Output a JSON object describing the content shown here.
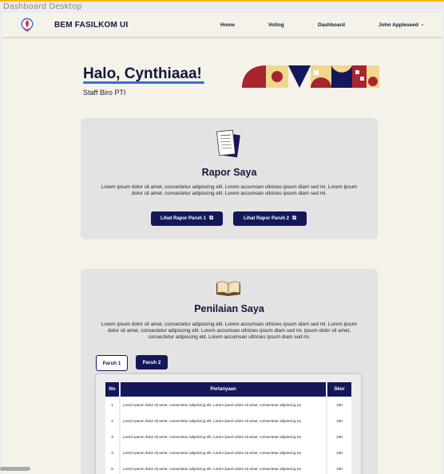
{
  "frame_label": "Dashboard Desktop",
  "nav": {
    "brand": "BEM FASILKOM UI",
    "links": [
      "Home",
      "Voting",
      "Dashboard"
    ],
    "user": "John Appleseed"
  },
  "hero": {
    "greeting": "Halo, Cynthiaaa!",
    "role": "Staff Biro PTI"
  },
  "rapor": {
    "title": "Rapor Saya",
    "description": "Lorem ipsum dolor sit amet, consectetur adipiscing elit. Lorem accumsan ultricies ipsum diam sed mi. Lorem ipsum dolor sit amet, consectetur adipiscing elit. Lorem accumsan ultricies ipsum diam sed mi.",
    "button1": "Lihat Rapor Paruh 1",
    "button2": "Lihat Rapor Paruh 2"
  },
  "penilaian": {
    "title": "Penilaian Saya",
    "description": "Lorem ipsum dolor sit amet, consectetur adipiscing elit. Lorem accumsan ultricies ipsum diam sed mi. Lorem ipsum dolor sit amet, consectetur adipiscing elit. Lorem accumsan ultricies ipsum diam sed mi. ipsum dolor sit amet, consectetur adipiscing elit. Lorem accumsan ultricies ipsum diam sed mi.",
    "tab1": "Paruh 1",
    "tab2": "Paruh 2",
    "table": {
      "headers": [
        "No",
        "Pertanyaan",
        "Skor"
      ],
      "rows": [
        [
          "1",
          "Lorem ipsum dolor sit amet, consectetur adipiscing elit. Lorem ipsum dolor sit amet, consectetur adipiscing ea",
          "100"
        ],
        [
          "2",
          "Lorem ipsum dolor sit amet, consectetur adipiscing elit. Lorem ipsum dolor sit amet, consectetur adipiscing ea",
          "100"
        ],
        [
          "3",
          "Lorem ipsum dolor sit amet, consectetur adipiscing elit. Lorem ipsum dolor sit amet, consectetur adipiscing ea",
          "100"
        ],
        [
          "4",
          "Lorem ipsum dolor sit amet, consectetur adipiscing elit. Lorem ipsum dolor sit amet, consectetur adipiscing ea",
          "100"
        ],
        [
          "5",
          "Lorem ipsum dolor sit amet, consectetur adipiscing elit. Lorem ipsum dolor sit amet, consectetur adipiscing ea",
          "100"
        ]
      ]
    }
  },
  "colors": {
    "navy": "#14175a",
    "accent_blue": "#2f6fd6",
    "banner_red": "#a8242e",
    "banner_yellow": "#f0d78e"
  }
}
